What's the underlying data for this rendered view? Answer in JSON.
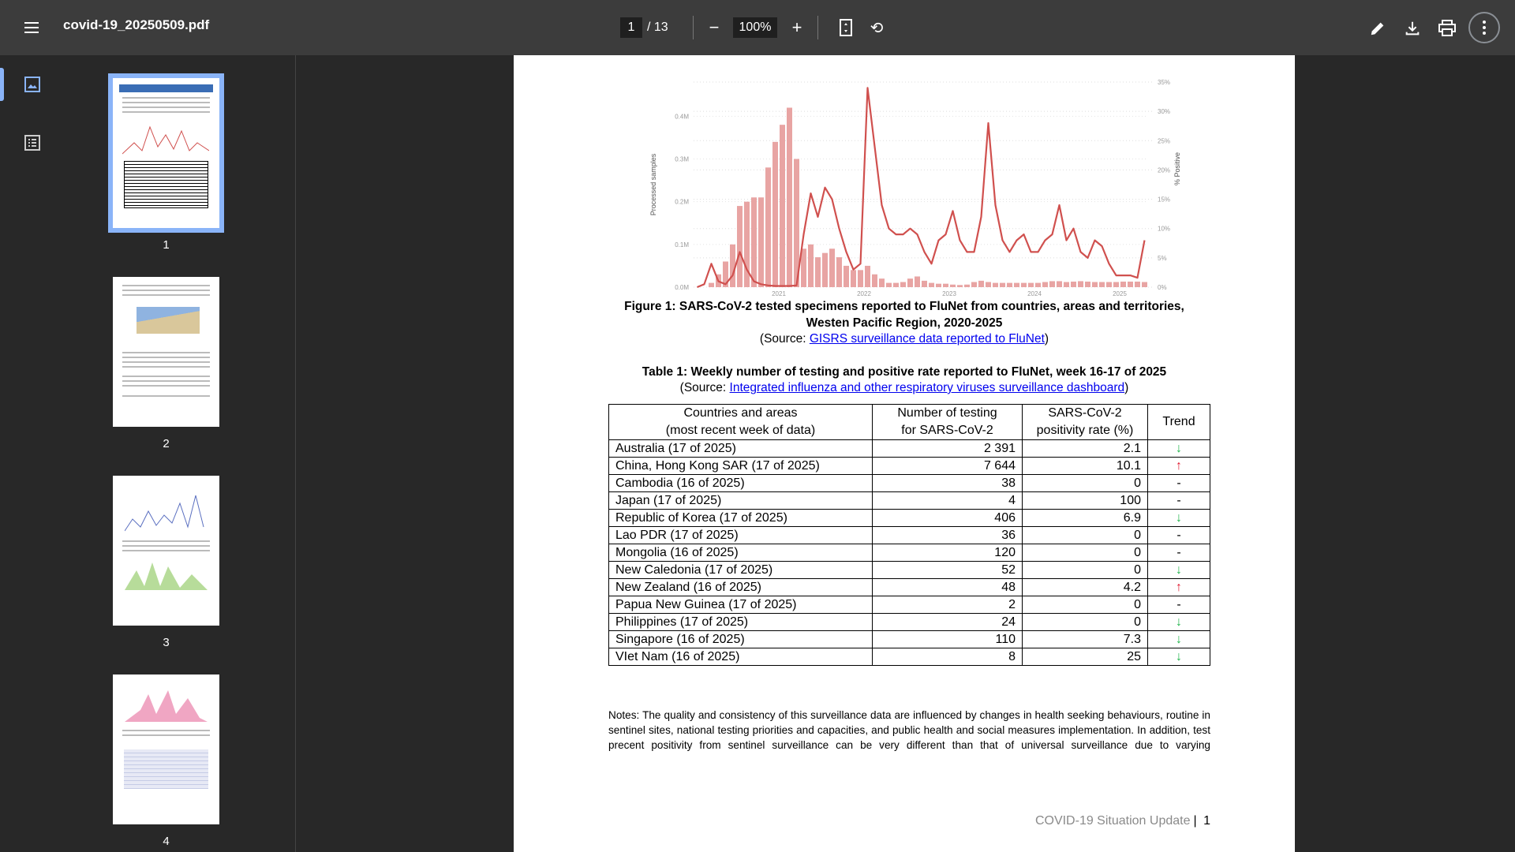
{
  "toolbar": {
    "title": "covid-19_20250509.pdf",
    "page_current": "1",
    "page_total": "/ 13",
    "zoom": "100%",
    "minus": "−",
    "plus": "+",
    "rotate": "⟲"
  },
  "sidebar": {
    "thumbnails": [
      {
        "label": "1",
        "selected": true
      },
      {
        "label": "2"
      },
      {
        "label": "3"
      },
      {
        "label": "4"
      }
    ]
  },
  "chart_data": {
    "type": "bar+line",
    "ylabel": "Processed samples",
    "y2label": "% Positive",
    "yticks": [
      "0.0M",
      "0.1M",
      "0.2M",
      "0.3M",
      "0.4M"
    ],
    "ylim": [
      0,
      0.48
    ],
    "y2ticks": [
      "0%",
      "5%",
      "10%",
      "15%",
      "20%",
      "25%",
      "30%",
      "35%"
    ],
    "y2lim": [
      0,
      35
    ],
    "xticks": [
      "2021",
      "2022",
      "2023",
      "2024",
      "2025"
    ],
    "start_month": "2020-01",
    "xlim": [
      "2020-01",
      "2025-04"
    ],
    "grid": true,
    "color": "#d0504e",
    "series": [
      {
        "kind": "bar",
        "axis": "left",
        "values": [
          0,
          0,
          0.01,
          0.03,
          0.06,
          0.1,
          0.19,
          0.2,
          0.21,
          0.21,
          0.28,
          0.34,
          0.38,
          0.42,
          0.3,
          0.09,
          0.1,
          0.07,
          0.08,
          0.09,
          0.07,
          0.05,
          0.04,
          0.04,
          0.05,
          0.03,
          0.02,
          0.01,
          0.01,
          0.012,
          0.02,
          0.025,
          0.015,
          0.01,
          0.008,
          0.008,
          0.006,
          0.005,
          0.006,
          0.012,
          0.015,
          0.012,
          0.01,
          0.01,
          0.01,
          0.01,
          0.01,
          0.01,
          0.01,
          0.012,
          0.014,
          0.014,
          0.012,
          0.013,
          0.014,
          0.013,
          0.012,
          0.012,
          0.012,
          0.012,
          0.013,
          0.013,
          0.013,
          0.012
        ]
      },
      {
        "kind": "line",
        "axis": "right",
        "values": [
          0,
          0.5,
          4,
          1,
          0.5,
          2,
          6,
          3,
          1,
          0.5,
          0.3,
          0.2,
          0.2,
          0.2,
          0.3,
          9,
          16,
          12,
          17,
          15,
          10,
          6,
          3,
          4,
          34,
          24,
          14,
          10,
          9,
          9,
          10,
          9,
          6,
          4,
          8,
          9,
          13,
          8,
          6,
          6,
          12,
          28,
          14,
          8,
          6,
          8,
          9,
          6,
          6,
          8,
          9,
          14,
          8,
          10,
          6,
          5,
          8,
          7,
          4,
          2,
          2,
          2,
          1.6,
          8
        ]
      }
    ]
  },
  "figure": {
    "caption_line1": "Figure 1: SARS-CoV-2 tested specimens reported to FluNet from countries, areas and territories,",
    "caption_line2": "Westen Pacific Region, 2020-2025",
    "source_prefix": "(Source: ",
    "source_link": "GISRS surveillance data reported to FluNet",
    "source_suffix": ")"
  },
  "table": {
    "title": "Table 1: Weekly number of testing and positive rate reported to FluNet, week 16-17 of 2025",
    "source_prefix": "(Source: ",
    "source_link": "Integrated influenza and other respiratory viruses surveillance dashboard",
    "source_suffix": ")",
    "headers": [
      [
        "Countries and areas",
        "(most recent week of data)"
      ],
      [
        "Number of testing",
        "for SARS-CoV-2"
      ],
      [
        "SARS-CoV-2",
        "positivity rate (%)"
      ],
      [
        "Trend",
        ""
      ]
    ],
    "rows": [
      [
        "Australia (17 of 2025)",
        "2 391",
        "2.1",
        "down"
      ],
      [
        "China, Hong Kong SAR (17 of 2025)",
        "7 644",
        "10.1",
        "up"
      ],
      [
        "Cambodia (16 of 2025)",
        "38",
        "0",
        "-"
      ],
      [
        "Japan (17 of 2025)",
        "4",
        "100",
        "-"
      ],
      [
        "Republic of Korea (17 of 2025)",
        "406",
        "6.9",
        "down"
      ],
      [
        "Lao PDR (17 of 2025)",
        "36",
        "0",
        "-"
      ],
      [
        "Mongolia (16 of 2025)",
        "120",
        "0",
        "-"
      ],
      [
        "New Caledonia (17 of 2025)",
        "52",
        "0",
        "down"
      ],
      [
        "New Zealand (16 of 2025)",
        "48",
        "4.2",
        "up"
      ],
      [
        "Papua New Guinea (17 of 2025)",
        "2",
        "0",
        "-"
      ],
      [
        "Philippines (17 of 2025)",
        "24",
        "0",
        "down"
      ],
      [
        "Singapore (16 of 2025)",
        "110",
        "7.3",
        "down"
      ],
      [
        "VIet Nam (16 of 2025)",
        "8",
        "25",
        "down"
      ]
    ],
    "trend_up_color": "#e0182e",
    "trend_down_color": "#1fb44a"
  },
  "notes": "Notes: The quality and consistency of this surveillance data are influenced by changes in health seeking behaviours, routine in sentinel sites, national testing priorities and capacities, and public health and social measures implementation. In addition, test precent positivity from sentinel surveillance can be very different than that of universal surveillance due to varying",
  "footer": {
    "text": "COVID-19 Situation Update",
    "sep": "|",
    "page": "1"
  }
}
